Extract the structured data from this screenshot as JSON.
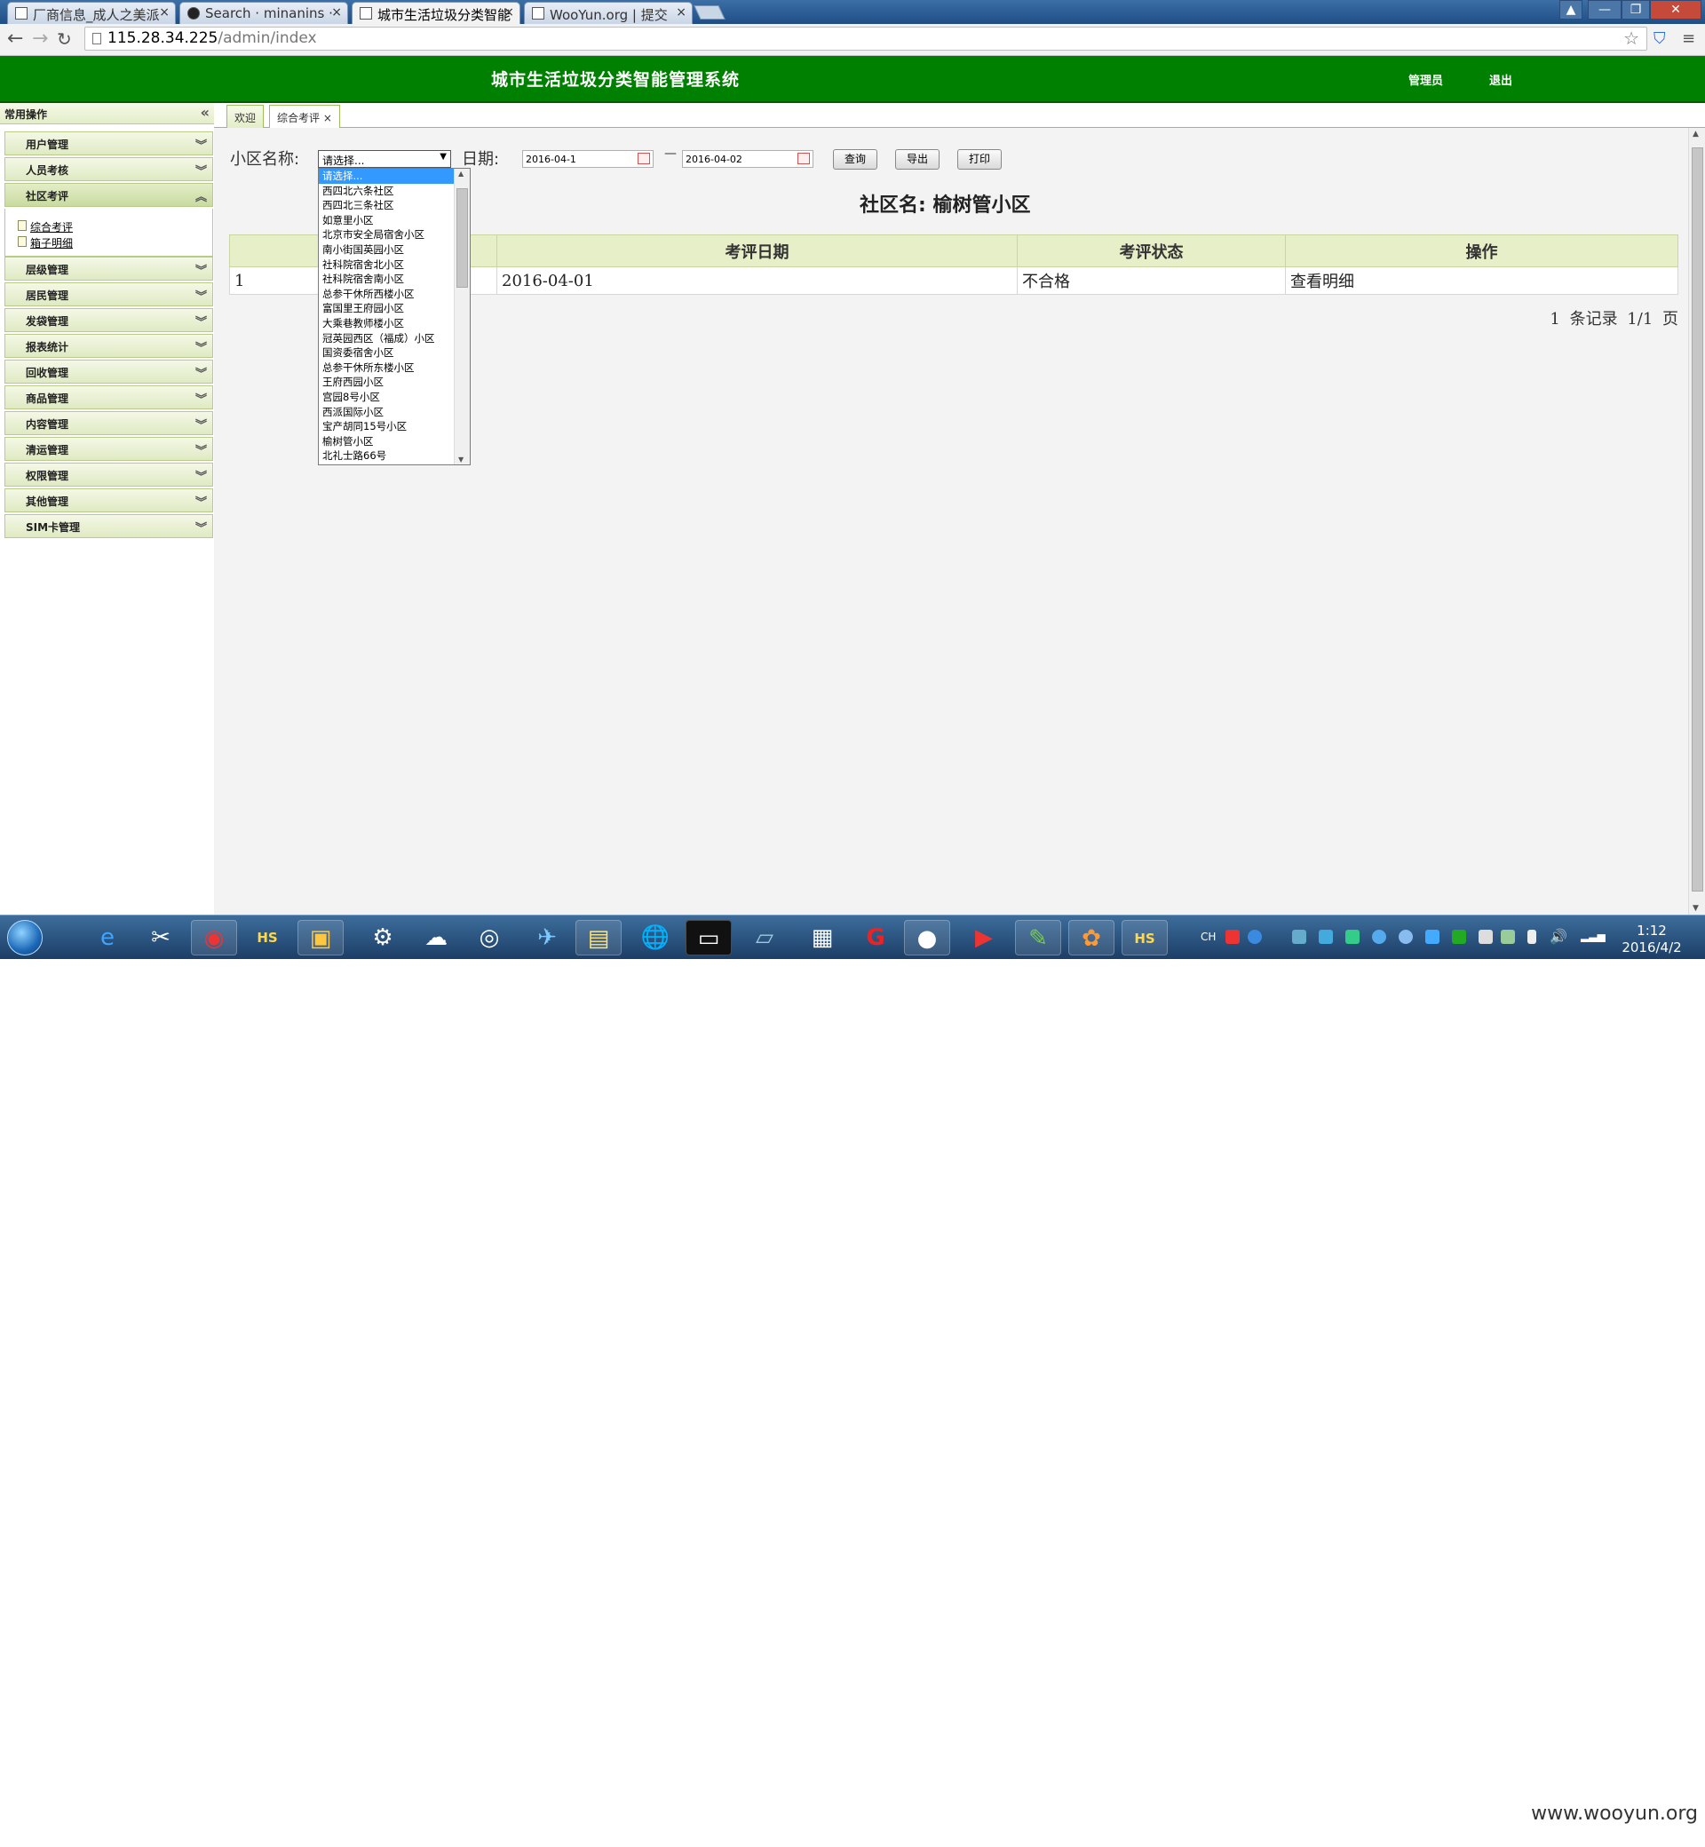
{
  "browser": {
    "tabs": [
      {
        "title": "厂商信息_成人之美派"
      },
      {
        "title": "Search · minanins ·"
      },
      {
        "title": "城市生活垃圾分类智能"
      },
      {
        "title": "WooYun.org | 提交"
      }
    ],
    "url_host": "115.28.34.225",
    "url_path": "/admin/index"
  },
  "header": {
    "title": "城市生活垃圾分类智能管理系统",
    "admin_label": "管理员",
    "logout_label": "退出"
  },
  "sidebar": {
    "heading": "常用操作",
    "items_top": [
      {
        "label": "用户管理"
      },
      {
        "label": "人员考核"
      },
      {
        "label": "社区考评"
      }
    ],
    "sub_items": [
      {
        "label": "综合考评"
      },
      {
        "label": "箱子明细"
      }
    ],
    "items_bottom": [
      {
        "label": "层级管理"
      },
      {
        "label": "居民管理"
      },
      {
        "label": "发袋管理"
      },
      {
        "label": "报表统计"
      },
      {
        "label": "回收管理"
      },
      {
        "label": "商品管理"
      },
      {
        "label": "内容管理"
      },
      {
        "label": "清运管理"
      },
      {
        "label": "权限管理"
      },
      {
        "label": "其他管理"
      },
      {
        "label": "SIM卡管理"
      }
    ]
  },
  "content_tabs": [
    {
      "label": "欢迎"
    },
    {
      "label": "综合考评"
    }
  ],
  "filters": {
    "area_label": "小区名称:",
    "area_value": "请选择...",
    "date_label": "日期:",
    "date_from": "2016-04-1",
    "date_sep": "—",
    "date_to": "2016-04-02",
    "query_btn": "查询",
    "export_btn": "导出",
    "print_btn": "打印"
  },
  "community_title": "社区名: 榆树管小区",
  "table": {
    "headers": [
      "",
      "",
      "考评日期",
      "考评状态",
      "操作"
    ],
    "rows": [
      [
        "1",
        "",
        "2016-04-01",
        "不合格",
        "查看明细"
      ]
    ]
  },
  "pager": "1 条记录 1/1 页",
  "dropdown_options": [
    "请选择...",
    "西四北六条社区",
    "西四北三条社区",
    "如意里小区",
    "北京市安全局宿舍小区",
    "南小街国英园小区",
    "社科院宿舍北小区",
    "社科院宿舍南小区",
    "总参干休所西楼小区",
    "富国里王府园小区",
    "大乘巷教师楼小区",
    "冠英园西区（福成）小区",
    "国资委宿舍小区",
    "总参干休所东楼小区",
    "王府西园小区",
    "宫园8号小区",
    "西派国际小区",
    "宝产胡同15号小区",
    "榆树管小区",
    "北礼士路66号"
  ],
  "taskbar": {
    "time": "1:12",
    "date": "2016/4/2",
    "ime": "CH"
  },
  "watermark": "www.wooyun.org"
}
